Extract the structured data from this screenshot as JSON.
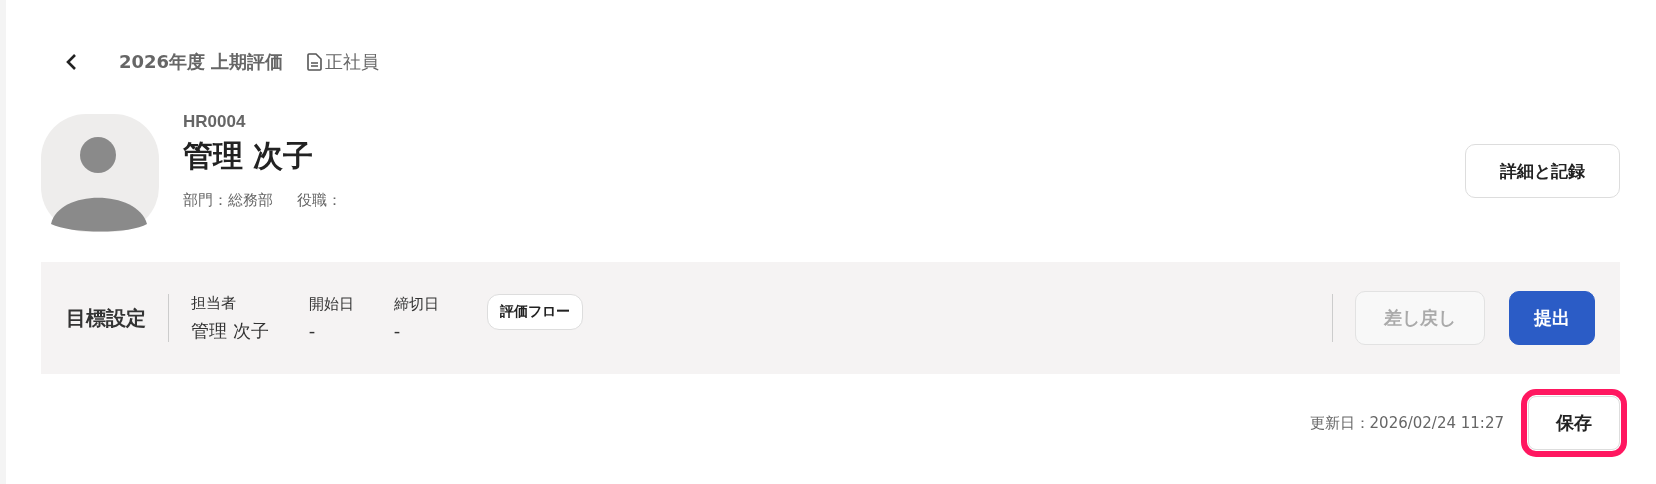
{
  "header": {
    "title": "2026年度 上期評価",
    "employment_type": "正社員"
  },
  "employee": {
    "code": "HR0004",
    "name": "管理 次子",
    "meta": [
      "部門：総務部",
      "役職："
    ],
    "details_button": "詳細と記録"
  },
  "stage_bar": {
    "stage": "目標設定",
    "fields": [
      {
        "label": "担当者",
        "value": "管理 次子"
      },
      {
        "label": "開始日",
        "value": "-"
      },
      {
        "label": "締切日",
        "value": "-"
      }
    ],
    "flow_button": "評価フロー",
    "actions": [
      {
        "label": "差し戻し",
        "kind": "secondary",
        "disabled": true
      },
      {
        "label": "提出",
        "kind": "primary",
        "disabled": false
      }
    ]
  },
  "footer": {
    "updated": "更新日：2026/02/24 11:27",
    "save_button": {
      "label": "保存",
      "highlighted": true
    }
  }
}
